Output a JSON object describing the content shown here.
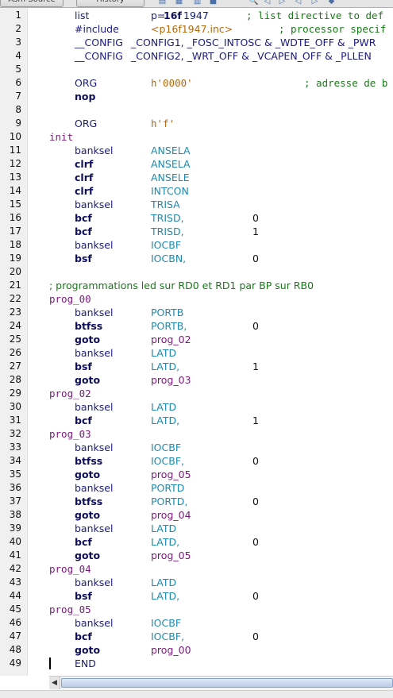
{
  "toolbar": {
    "tabs": [
      "Asm Source",
      "History"
    ],
    "icons": [
      "file-icon",
      "save-icon",
      "back-icon",
      "search-icon",
      "arrow-left-icon",
      "arrow-right-icon",
      "arrow-up-icon",
      "arrow-down-icon",
      "bookmark-icon"
    ]
  },
  "editor": {
    "line_numbers": [
      "1",
      "2",
      "3",
      "4",
      "5",
      "6",
      "7",
      "8",
      "9",
      "10",
      "11",
      "12",
      "13",
      "14",
      "15",
      "16",
      "17",
      "18",
      "19",
      "20",
      "21",
      "22",
      "23",
      "24",
      "25",
      "26",
      "27",
      "28",
      "29",
      "30",
      "31",
      "32",
      "33",
      "34",
      "35",
      "36",
      "37",
      "38",
      "39",
      "40",
      "41",
      "42",
      "43",
      "44",
      "45",
      "46",
      "47",
      "48",
      "49"
    ],
    "lines": [
      {
        "t": "dir_list",
        "a": "list",
        "p": "p=",
        "b": "16f",
        "c": "1947",
        "cm": "; list directive to def"
      },
      {
        "t": "dir_inc",
        "a": "#include",
        "b": "<p16f1947.inc>",
        "cm": "; processor specif"
      },
      {
        "t": "cfg",
        "a": "__CONFIG",
        "b": "_CONFIG1, _FOSC_INTOSC & _WDTE_OFF & _PWR"
      },
      {
        "t": "cfg",
        "a": "__CONFIG",
        "b": "_CONFIG2, _WRT_OFF & _VCAPEN_OFF & _PLLEN"
      },
      {
        "t": "empty"
      },
      {
        "t": "org",
        "a": "ORG",
        "b": "h'0000'",
        "cm": "; adresse de b"
      },
      {
        "t": "op",
        "a": "nop"
      },
      {
        "t": "empty"
      },
      {
        "t": "org",
        "a": "ORG",
        "b": "h'f'"
      },
      {
        "t": "label",
        "a": "init"
      },
      {
        "t": "ins",
        "a": "banksel",
        "b": "ANSELA"
      },
      {
        "t": "insb",
        "a": "clrf",
        "b": "ANSELA"
      },
      {
        "t": "insb",
        "a": "clrf",
        "b": "ANSELE"
      },
      {
        "t": "insb",
        "a": "clrf",
        "b": "INTCON"
      },
      {
        "t": "ins",
        "a": "banksel",
        "b": "TRISA"
      },
      {
        "t": "insb",
        "a": "bcf",
        "b": "TRISD,",
        "c": "0"
      },
      {
        "t": "insb",
        "a": "bcf",
        "b": "TRISD,",
        "c": "1"
      },
      {
        "t": "ins",
        "a": "banksel",
        "b": "IOCBF"
      },
      {
        "t": "insb",
        "a": "bsf",
        "b": "IOCBN,",
        "c": "0"
      },
      {
        "t": "empty"
      },
      {
        "t": "comment",
        "a": "; programmations led sur RD0 et RD1 par BP sur RB0"
      },
      {
        "t": "label",
        "a": "prog_00"
      },
      {
        "t": "ins",
        "a": "banksel",
        "b": "PORTB"
      },
      {
        "t": "insb",
        "a": "btfss",
        "b": "PORTB,",
        "c": "0"
      },
      {
        "t": "goto",
        "a": "goto",
        "b": "prog_02"
      },
      {
        "t": "ins",
        "a": "banksel",
        "b": "LATD"
      },
      {
        "t": "insb",
        "a": "bsf",
        "b": "LATD,",
        "c": "1"
      },
      {
        "t": "goto",
        "a": "goto",
        "b": "prog_03"
      },
      {
        "t": "label",
        "a": "prog_02"
      },
      {
        "t": "ins",
        "a": "banksel",
        "b": "LATD"
      },
      {
        "t": "insb",
        "a": "bcf",
        "b": "LATD,",
        "c": "1"
      },
      {
        "t": "label",
        "a": "prog_03"
      },
      {
        "t": "ins",
        "a": "banksel",
        "b": "IOCBF"
      },
      {
        "t": "insb",
        "a": "btfss",
        "b": "IOCBF,",
        "c": "0"
      },
      {
        "t": "goto",
        "a": "goto",
        "b": "prog_05"
      },
      {
        "t": "ins",
        "a": "banksel",
        "b": "PORTD"
      },
      {
        "t": "insb",
        "a": "btfss",
        "b": "PORTD,",
        "c": "0"
      },
      {
        "t": "goto",
        "a": "goto",
        "b": "prog_04"
      },
      {
        "t": "ins",
        "a": "banksel",
        "b": "LATD"
      },
      {
        "t": "insb",
        "a": "bcf",
        "b": "LATD,",
        "c": "0"
      },
      {
        "t": "goto",
        "a": "goto",
        "b": "prog_05"
      },
      {
        "t": "label",
        "a": "prog_04"
      },
      {
        "t": "ins",
        "a": "banksel",
        "b": "LATD"
      },
      {
        "t": "insb",
        "a": "bsf",
        "b": "LATD,",
        "c": "0"
      },
      {
        "t": "label",
        "a": "prog_05"
      },
      {
        "t": "ins",
        "a": "banksel",
        "b": "IOCBF"
      },
      {
        "t": "insb",
        "a": "bcf",
        "b": "IOCBF,",
        "c": "0"
      },
      {
        "t": "goto",
        "a": "goto",
        "b": "prog_00"
      },
      {
        "t": "ins",
        "a": "END"
      }
    ]
  },
  "colors": {
    "directive": "#1b1b7e",
    "opcode": "#0e0e5c",
    "register": "#1e8ab0",
    "label": "#7a1a7a",
    "comment": "#1a7a1a",
    "string": "#b26a10"
  }
}
